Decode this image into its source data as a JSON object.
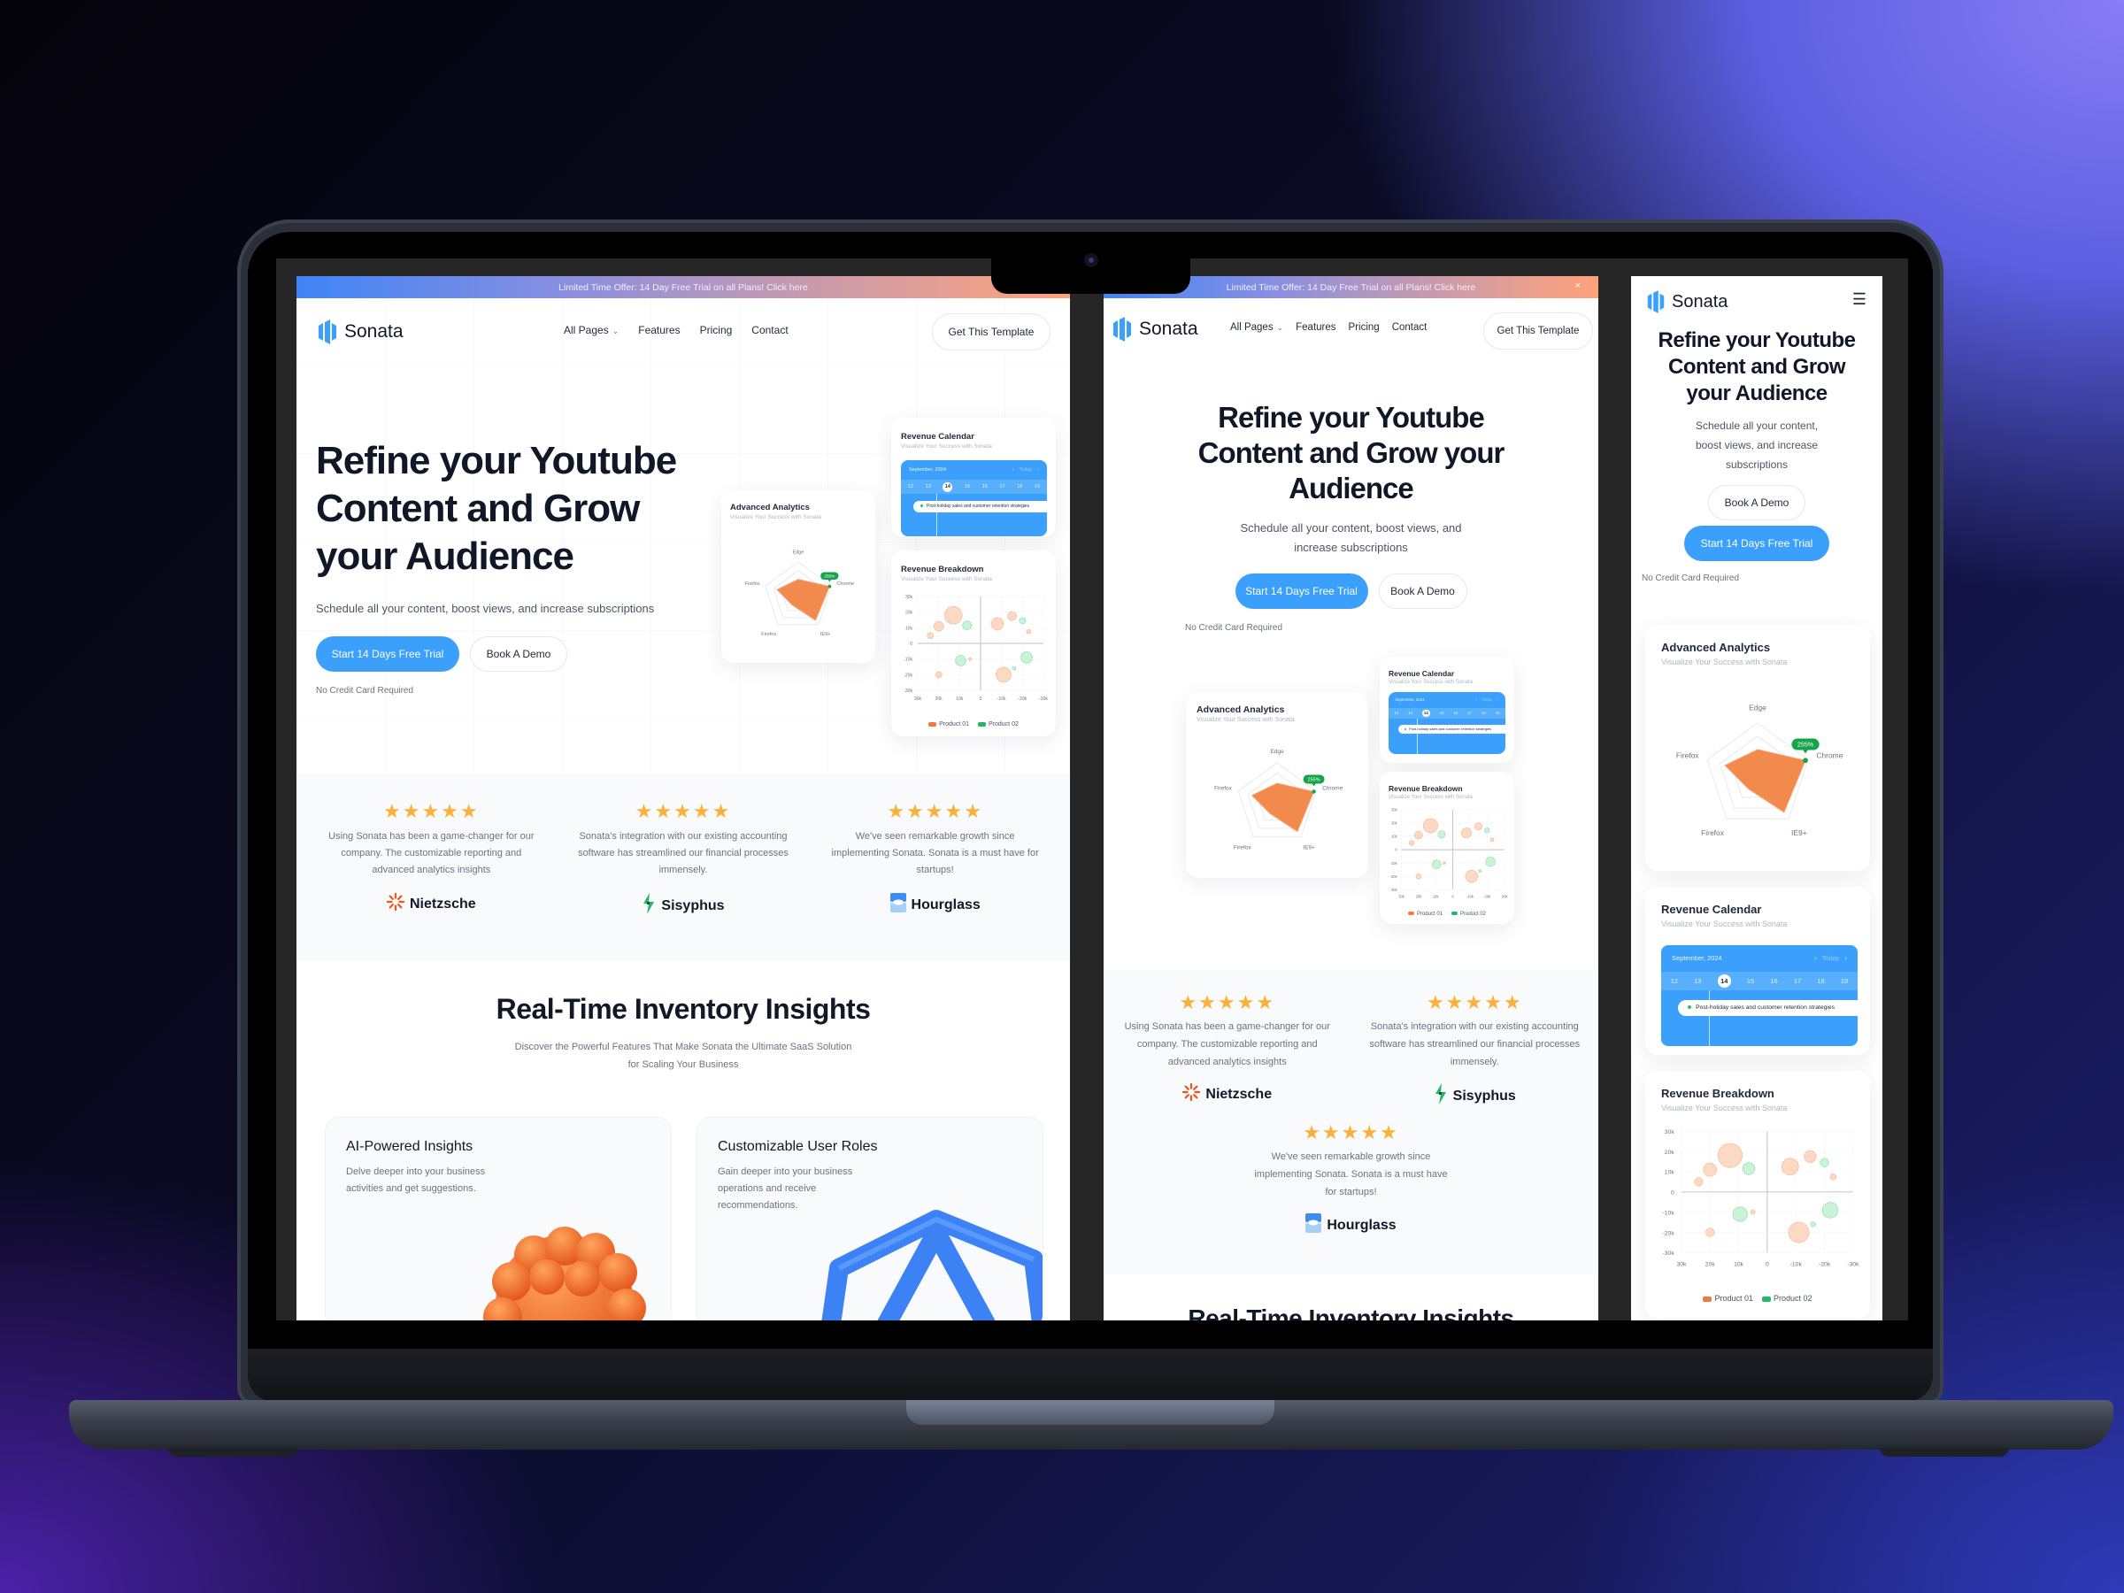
{
  "brand": {
    "name": "Sonata",
    "accent": "#3ba0fb",
    "radar_fill": "#f28a4e",
    "product1_color": "#f7a77a",
    "product2_color": "#6fd99a",
    "star_color": "#fbb03b"
  },
  "promo": {
    "text": "Limited Time Offer: 14 Day Free Trial on all Plans!  Click here",
    "close": "×"
  },
  "nav": {
    "items": [
      "All Pages",
      "Features",
      "Pricing",
      "Contact"
    ],
    "cta": "Get This Template",
    "menu_icon": "☰"
  },
  "hero": {
    "title": "Refine your Youtube Content and Grow your Audience",
    "subtitle": "Schedule all your content, boost views, and increase subscriptions",
    "primary_cta": "Start 14 Days Free Trial",
    "secondary_cta": "Book A Demo",
    "note": "No Credit Card Required"
  },
  "analytics_card": {
    "title": "Advanced Analytics",
    "subtitle": "Visualize Your Success with Sonata",
    "badge": "255%"
  },
  "calendar_card": {
    "title": "Revenue Calendar",
    "subtitle": "Visualize Your Success with Sonata",
    "month": "September, 2024",
    "today": "Today",
    "prev": "‹",
    "next": "›",
    "days": [
      "12",
      "13",
      "14",
      "15",
      "16",
      "17",
      "18",
      "19"
    ],
    "selected_day": "14",
    "event": "Post-holiday sales and customer retention strategies"
  },
  "breakdown_card": {
    "title": "Revenue Breakdown",
    "subtitle": "Visualize Your Success with Sonata"
  },
  "chart_data": [
    {
      "type": "radar",
      "title": "Advanced Analytics",
      "axes": [
        "Edge",
        "Chrome",
        "IE9+",
        "Firefox",
        "Firefox"
      ],
      "values": [
        0.5,
        0.95,
        0.85,
        0.3,
        0.65
      ],
      "max": 1,
      "rings": 4,
      "annotation": {
        "axis": "Chrome",
        "label": "255%"
      }
    },
    {
      "type": "scatter",
      "title": "Revenue Breakdown",
      "x_ticks": [
        "30k",
        "20k",
        "10k",
        "0",
        "-10k",
        "-20k",
        "-30k"
      ],
      "y_ticks": [
        "30k",
        "20k",
        "10k",
        "0",
        "-10k",
        "-20k",
        "-30k"
      ],
      "xlim": [
        30,
        -30
      ],
      "ylim": [
        -30,
        30
      ],
      "grid": true,
      "legend": "bottom",
      "series": [
        {
          "name": "Product 01",
          "points": [
            [
              13,
              18,
              10
            ],
            [
              20,
              11,
              5.5
            ],
            [
              24,
              5,
              3.5
            ],
            [
              -8,
              12.5,
              7
            ],
            [
              -15,
              17.5,
              5
            ],
            [
              -23,
              7.5,
              2.5
            ],
            [
              5,
              -10,
              1.8
            ],
            [
              20,
              -20,
              3.5
            ],
            [
              -11,
              -20,
              8.5
            ]
          ]
        },
        {
          "name": "Product 02",
          "points": [
            [
              6.5,
              11.5,
              5
            ],
            [
              -20,
              14.5,
              3.5
            ],
            [
              9.5,
              -11,
              6
            ],
            [
              -16,
              -16,
              2
            ],
            [
              -22,
              -9,
              6.5
            ]
          ]
        }
      ]
    }
  ],
  "testimonials": [
    {
      "stars": "★★★★★",
      "quote": "Using Sonata has been a game-changer for our company. The customizable reporting and advanced analytics insights",
      "company": "Nietzsche"
    },
    {
      "stars": "★★★★★",
      "quote": "Sonata's integration with our existing accounting software has streamlined our financial processes immensely.",
      "company": "Sisyphus"
    },
    {
      "stars": "★★★★★",
      "quote": "We've seen remarkable growth since implementing Sonata. Sonata is a must have for startups!",
      "company": "Hourglass"
    }
  ],
  "features": {
    "title": "Real-Time Inventory Insights",
    "subtitle": "Discover the Powerful Features That Make Sonata the Ultimate SaaS Solution for Scaling Your Business",
    "cards": [
      {
        "title": "AI-Powered Insights",
        "desc": "Delve deeper into your business activities and get suggestions."
      },
      {
        "title": "Customizable User Roles",
        "desc": "Gain deeper into your business operations and receive recommendations."
      }
    ]
  }
}
